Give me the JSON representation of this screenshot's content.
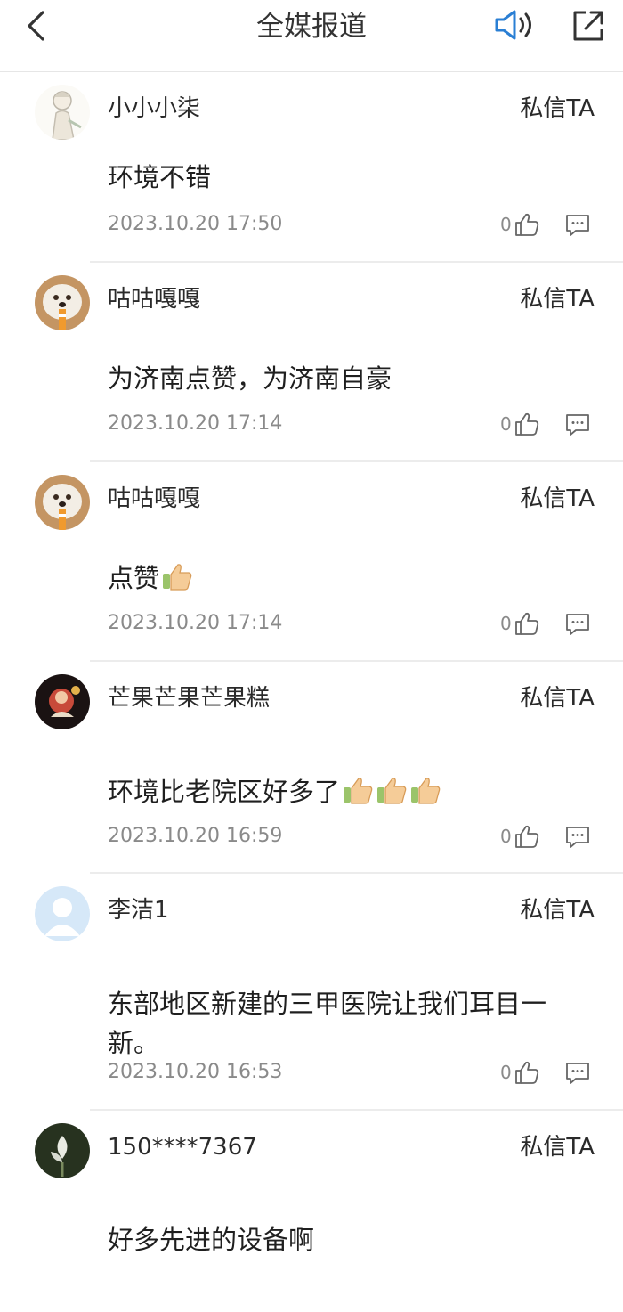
{
  "header": {
    "title": "全媒报道"
  },
  "comments": [
    {
      "user": "小小小柒",
      "dm": "私信TA",
      "text": "环境不错",
      "emojis": 0,
      "time": "2023.10.20 17:50",
      "likes": "0"
    },
    {
      "user": "咕咕嘎嘎",
      "dm": "私信TA",
      "text": "为济南点赞，为济南自豪",
      "emojis": 0,
      "time": "2023.10.20 17:14",
      "likes": "0"
    },
    {
      "user": "咕咕嘎嘎",
      "dm": "私信TA",
      "text": "点赞",
      "emojis": 1,
      "time": "2023.10.20 17:14",
      "likes": "0"
    },
    {
      "user": "芒果芒果芒果糕",
      "dm": "私信TA",
      "text": "环境比老院区好多了",
      "emojis": 3,
      "time": "2023.10.20 16:59",
      "likes": "0"
    },
    {
      "user": "李洁1",
      "dm": "私信TA",
      "text": "东部地区新建的三甲医院让我们耳目一新。",
      "emojis": 0,
      "time": "2023.10.20 16:53",
      "likes": "0"
    },
    {
      "user": "150****7367",
      "dm": "私信TA",
      "text": "好多先进的设备啊",
      "emojis": 0,
      "time": "",
      "likes": ""
    }
  ]
}
